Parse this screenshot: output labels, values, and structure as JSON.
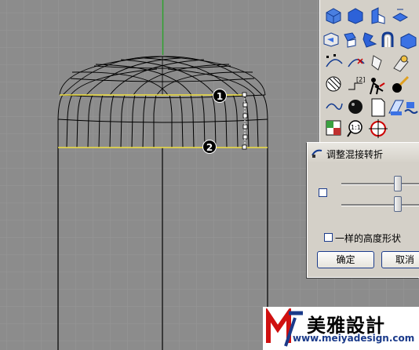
{
  "viewport": {
    "name": "perspective-viewport",
    "callouts": [
      "1",
      "2"
    ],
    "colors": {
      "grid": "#979797",
      "background": "#8c8c8c",
      "axis": "#2ca02c",
      "highlight": "#f0e040"
    }
  },
  "toolbar": {
    "rows": [
      [
        "solid-box-icon",
        "solid-edit-icon",
        "solid-split-icon",
        "solid-split-alt-icon"
      ],
      [
        "solid-offset-icon",
        "solid-cut-icon",
        "solid-cut-blue-icon",
        "solid-fillet-icon",
        "solid-boolean-icon"
      ],
      [
        "edit-points-icon",
        "edit-points-alt-icon",
        "bend-icon",
        "project-icon"
      ],
      [
        "hatch-icon",
        "dimension-icon",
        "render-icon",
        "paint-icon"
      ],
      [
        "surface-blend-icon",
        "sphere-render-icon",
        "page-icon",
        "texture-icon",
        "waves-icon"
      ],
      [
        "layer-grid-icon",
        "zoom-icon",
        "target-icon"
      ]
    ]
  },
  "dialog": {
    "title": "调整混接转折",
    "same_height_shape_label": "一样的高度形状",
    "ok_label": "确定",
    "cancel_label": "取消",
    "slider1_value": 0.8,
    "slider2_value": 0.8
  },
  "watermark": {
    "brand": "美雅設計",
    "url": "www.meiyadesign.com"
  }
}
